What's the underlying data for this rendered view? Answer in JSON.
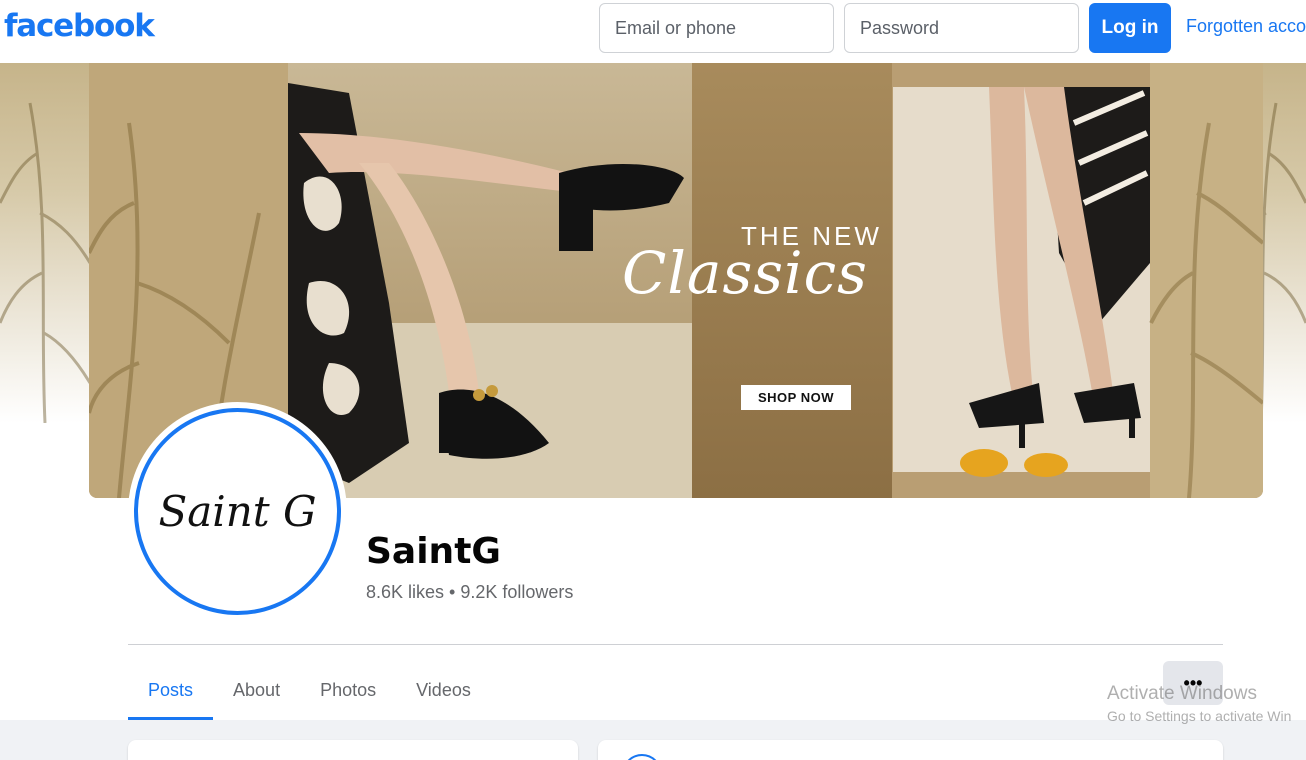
{
  "header": {
    "logo": "facebook",
    "email_placeholder": "Email or phone",
    "password_placeholder": "Password",
    "login_label": "Log in",
    "forgot_label": "Forgotten acco"
  },
  "cover": {
    "headline": "THE NEW",
    "script": "Classics",
    "cta": "SHOP NOW"
  },
  "profile": {
    "avatar_text": "Saint G",
    "name": "SaintG",
    "stats": "8.6K likes • 9.2K followers"
  },
  "tabs": [
    {
      "label": "Posts"
    },
    {
      "label": "About"
    },
    {
      "label": "Photos"
    },
    {
      "label": "Videos"
    }
  ],
  "more_label": "•••",
  "watermark": {
    "title": "Activate Windows",
    "subtitle": "Go to Settings to activate Win"
  },
  "colors": {
    "brand": "#1877f2",
    "muted_text": "#65676b",
    "feed_bg": "#f0f2f5"
  }
}
